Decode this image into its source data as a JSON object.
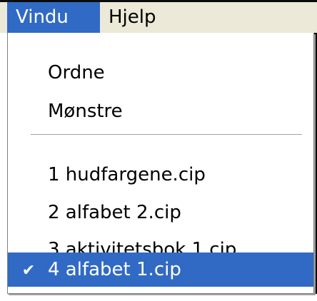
{
  "menubar": {
    "vindu_label": "Vindu",
    "hjelp_label": "Hjelp"
  },
  "dropdown": {
    "items": [
      {
        "label": "Ordne"
      },
      {
        "label": "Mønstre"
      },
      {
        "label": "1 hudfargene.cip"
      },
      {
        "label": "2 alfabet 2.cip"
      },
      {
        "label": "3 aktivitetsbok 1.cip"
      },
      {
        "label": "4 alfabet 1.cip",
        "checked": true,
        "check_glyph": "✔"
      }
    ]
  },
  "colors": {
    "highlight": "#316ac5",
    "menubar_bg": "#ece9d8",
    "highlight_text": "#ffffff"
  }
}
